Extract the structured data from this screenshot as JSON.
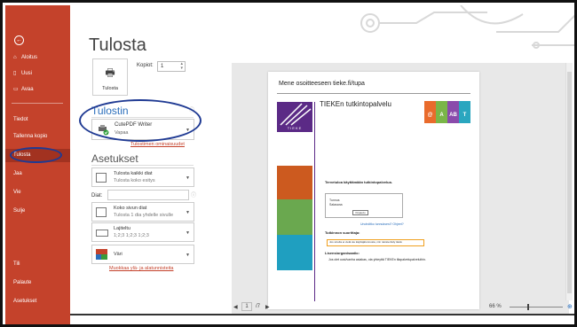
{
  "sidebar": {
    "back_icon": "back-arrow-icon",
    "items": [
      {
        "label": "Aloitus",
        "icon": "⌂"
      },
      {
        "label": "Uusi",
        "icon": "▯"
      },
      {
        "label": "Avaa",
        "icon": "▭"
      },
      {
        "label": "Tiedot",
        "icon": ""
      },
      {
        "label": "Tallenna kopio",
        "icon": ""
      },
      {
        "label": "Tulosta",
        "icon": "",
        "active": true
      },
      {
        "label": "Jaa",
        "icon": ""
      },
      {
        "label": "Vie",
        "icon": ""
      },
      {
        "label": "Sulje",
        "icon": ""
      },
      {
        "label": "Tili",
        "icon": ""
      },
      {
        "label": "Palaute",
        "icon": ""
      },
      {
        "label": "Asetukset",
        "icon": ""
      }
    ]
  },
  "main": {
    "title": "Tulosta",
    "print_button": "Tulosta",
    "copies_label": "Kopiot:",
    "copies_value": "1"
  },
  "printer": {
    "section_title": "Tulostin",
    "name": "CutePDF Writer",
    "status": "Vapaa",
    "properties_link": "Tulostimen ominaisuudet"
  },
  "settings": {
    "section_title": "Asetukset",
    "range": {
      "title": "Tulosta kaikki diat",
      "sub": "Tulosta koko esitys"
    },
    "slides_label": "Diat:",
    "layout": {
      "title": "Koko sivun diat",
      "sub": "Tulosta 1 dia yhdelle sivulle"
    },
    "collate": {
      "title": "Lajiteltu",
      "sub": "1;2;3   1;2;3   1;2;3"
    },
    "color": {
      "title": "Väri"
    },
    "header_footer_link": "Muokkaa ylä- ja alatunnisteita"
  },
  "preview": {
    "heading": "Mene osoitteeseen tieke.fi/tupa",
    "logo_text": "TIEKE",
    "service_title": "TIEKEn tutkintopalvelu",
    "tiles": [
      "@",
      "A",
      "AB",
      "T"
    ],
    "welcome": "Tervetuloa käyttämään tutkintopalvelua.",
    "form_user": "Tunnus",
    "form_pass": "Salasana",
    "form_button": "Kirjaudu",
    "forgot": "Unohditko tunnuksesi? Ohjeet?",
    "instructions_heading": "Tutkinnon suorittaja:",
    "instructions_note": "Jos sinulla ei vielä ole käyttäjätunnusta, niin rekisteröidy tästä",
    "admin_heading": "Lisensiorganisaatio:",
    "admin_note": "Jos olet uusi/vanha asiakas, ota yhteyttä TIEKEn tilapalvelupalveluihin."
  },
  "bottom": {
    "page_current": "1",
    "page_total": "/7",
    "zoom": "66 %"
  },
  "colors": {
    "sidebar": "#c4422b",
    "sidebar_active": "#a23220",
    "annotation": "#1f3a93",
    "tieke_purple": "#5b2a86"
  }
}
